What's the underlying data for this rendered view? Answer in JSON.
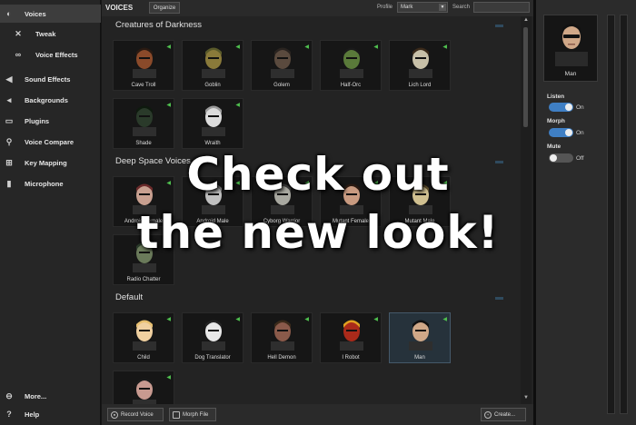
{
  "sidebar": {
    "items": [
      {
        "label": "Voices",
        "icon": "voices-icon",
        "glyph": "◐",
        "active": true
      },
      {
        "label": "Tweak",
        "icon": "wrench-icon",
        "glyph": "✕",
        "indent": true
      },
      {
        "label": "Voice Effects",
        "icon": "effects-icon",
        "glyph": "∞",
        "indent": true
      },
      {
        "label": "Sound Effects",
        "icon": "speaker-icon",
        "glyph": "◀",
        "active": false
      },
      {
        "label": "Backgrounds",
        "icon": "backgrounds-icon",
        "glyph": "◂",
        "active": false
      },
      {
        "label": "Plugins",
        "icon": "plugin-icon",
        "glyph": "▭",
        "active": false
      },
      {
        "label": "Voice Compare",
        "icon": "magnifier-icon",
        "glyph": "⚲",
        "active": false
      },
      {
        "label": "Key Mapping",
        "icon": "keyboard-icon",
        "glyph": "⊞",
        "active": false
      },
      {
        "label": "Microphone",
        "icon": "microphone-icon",
        "glyph": "▮",
        "active": false
      }
    ],
    "more": {
      "label": "More...",
      "icon": "more-icon",
      "glyph": "⊖"
    },
    "help": {
      "label": "Help",
      "icon": "help-icon",
      "glyph": "?"
    }
  },
  "topbar": {
    "title": "VOICES",
    "organize": "Organize",
    "profile_label": "Profile",
    "profile_value": "Mark",
    "search_label": "Search",
    "search_value": ""
  },
  "categories": [
    {
      "name": "Creatures of Darkness",
      "voices": [
        {
          "label": "Cave Troll",
          "skin": "#8a4a2a",
          "hair": "#2a1a12"
        },
        {
          "label": "Goblin",
          "skin": "#8a7a3a",
          "hair": "#5a5a2a"
        },
        {
          "label": "Golem",
          "skin": "#5a4a3e",
          "hair": "#2a2420"
        },
        {
          "label": "Half-Orc",
          "skin": "#5a7a3a",
          "hair": "#1a1a1a"
        },
        {
          "label": "Lich Lord",
          "skin": "#c8c0a8",
          "hair": "#3a2a1a"
        },
        {
          "label": "Shade",
          "skin": "#2a3a2a",
          "hair": "#0e1a0e"
        },
        {
          "label": "Wraith",
          "skin": "#dcdcdc",
          "hair": "#9a9a9a"
        }
      ]
    },
    {
      "name": "Deep Space Voices",
      "voices": [
        {
          "label": "Android Female",
          "skin": "#c8a090",
          "hair": "#6a2a2a"
        },
        {
          "label": "Android Male",
          "skin": "#c0c0c0",
          "hair": "#7a7a7a"
        },
        {
          "label": "Cyborg Warrior",
          "skin": "#a8a8a0",
          "hair": "#3a3a3a"
        },
        {
          "label": "Mutant Female",
          "skin": "#c89a80",
          "hair": "#2a1a12"
        },
        {
          "label": "Mutant Male",
          "skin": "#d0c090",
          "hair": "#5a4a2a"
        },
        {
          "label": "Radio Chatter",
          "skin": "#6a7a5a",
          "hair": "#2a3a2a"
        }
      ]
    },
    {
      "name": "Default",
      "voices": [
        {
          "label": "Child",
          "skin": "#f0d0a0",
          "hair": "#e8c070"
        },
        {
          "label": "Dog Translator",
          "skin": "#e8e8e8",
          "hair": "#222222"
        },
        {
          "label": "Hell Demon",
          "skin": "#8a5a4a",
          "hair": "#3a2a1a"
        },
        {
          "label": "I Robot",
          "skin": "#aa2a1a",
          "hair": "#e0a020"
        },
        {
          "label": "Man",
          "skin": "#d0a888",
          "hair": "#111111",
          "selected": true
        },
        {
          "label": "",
          "skin": "#c89a90",
          "hair": "#1a1a1a"
        }
      ]
    }
  ],
  "bottombar": {
    "record": "Record Voice",
    "morph_file": "Morph File",
    "create": "Create..."
  },
  "right_panel": {
    "preview_name": "Man",
    "listen_label": "Listen",
    "listen_state": "On",
    "morph_label": "Morph",
    "morph_state": "On",
    "mute_label": "Mute",
    "mute_state": "Off"
  },
  "overlay": {
    "line1": "Check out",
    "line2": "the new look!"
  },
  "colors": {
    "accent": "#3f7fc4",
    "sound_indicator": "#4fbf4f",
    "selected_tile": "#26323b"
  }
}
